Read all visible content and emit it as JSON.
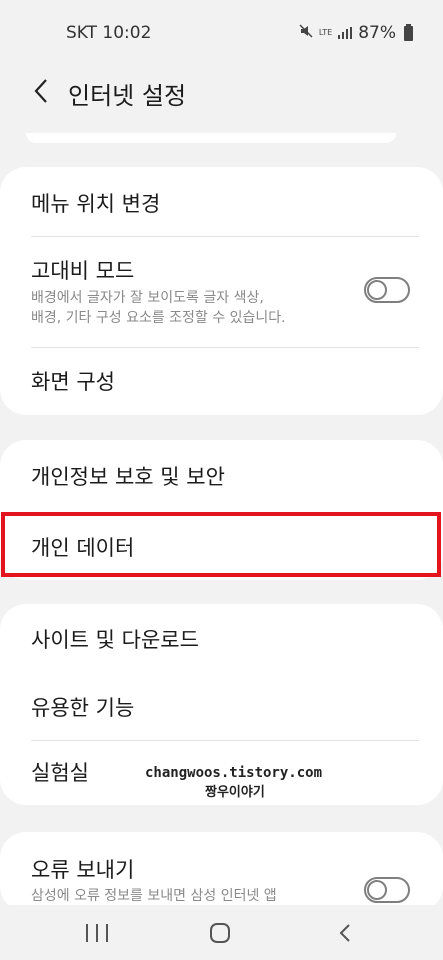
{
  "status": {
    "carrier_time": "SKT 10:02",
    "lte": "LTE",
    "battery": "87%"
  },
  "header": {
    "title": "인터넷 설정"
  },
  "sections": {
    "display": {
      "menu_position": "메뉴 위치 변경",
      "high_contrast": {
        "label": "고대비 모드",
        "desc_line1": "배경에서 글자가 잘 보이도록 글자 색상,",
        "desc_line2": "배경, 기타 구성 요소를 조정할 수 있습니다.",
        "enabled": false
      },
      "screen_layout": "화면 구성"
    },
    "privacy": {
      "privacy_security": "개인정보 보호 및 보안",
      "personal_data": "개인 데이터"
    },
    "more": {
      "sites_downloads": "사이트 및 다운로드",
      "useful_features": "유용한 기능",
      "labs": "실험실"
    },
    "feedback": {
      "error_report": "오류 보내기",
      "desc": "삼성에 오류 정보를 보내면 삼성 인터넷 앱",
      "enabled": false
    }
  },
  "watermark": {
    "line1": "changwoos.tistory.com",
    "line2": "짱우이야기"
  },
  "colors": {
    "highlight": "#e4141e",
    "background": "#f2f2f2",
    "card": "#ffffff"
  }
}
